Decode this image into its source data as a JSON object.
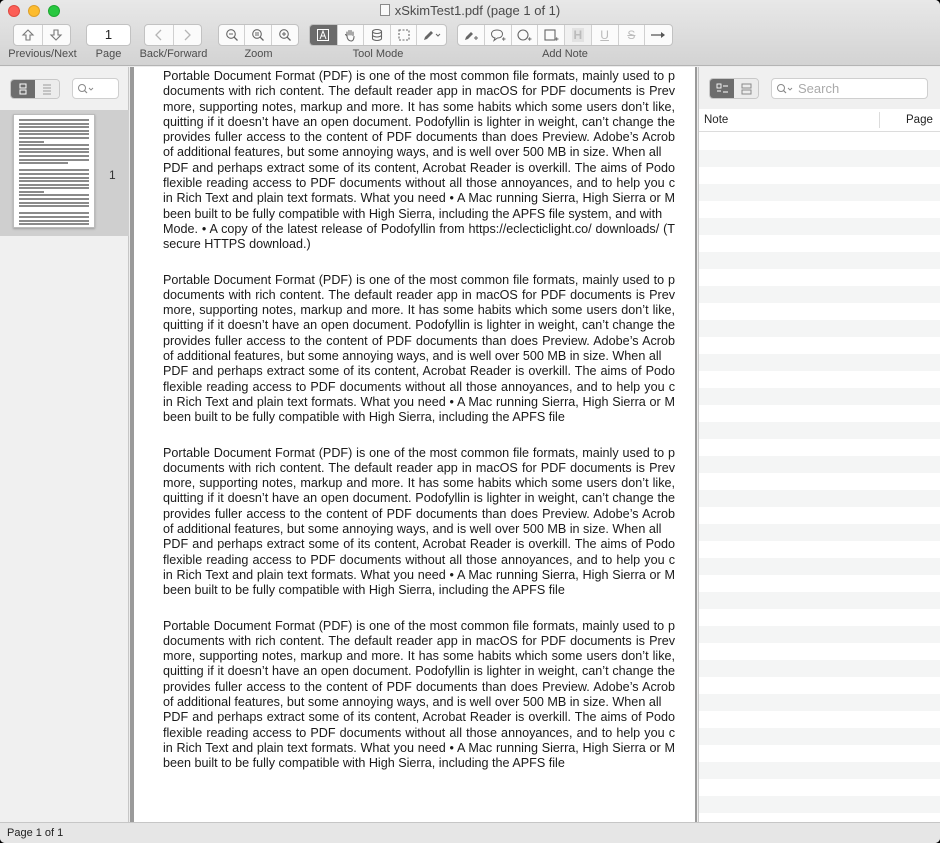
{
  "window": {
    "title": "xSkimTest1.pdf (page 1 of 1)"
  },
  "toolbar": {
    "page_number": "1",
    "labels": {
      "previous_next": "Previous/Next",
      "page": "Page",
      "back_forward": "Back/Forward",
      "zoom": "Zoom",
      "tool_mode": "Tool Mode",
      "add_note": "Add Note"
    },
    "add_note_letter_h": "H",
    "add_note_letter_u": "U",
    "add_note_letter_s": "S",
    "active_tool": "text-tool"
  },
  "left_sidebar": {
    "thumbnails": [
      {
        "page_label": "1"
      }
    ]
  },
  "document": {
    "blocks": [
      {
        "p1": "Portable Document Format (PDF) is one of the most common file formats, mainly used to p documents with rich content. The default reader app in macOS for PDF documents is Prev more, supporting notes, markup and more. It has some habits which some users don’t like, quitting if it doesn’t have an open document. Podofyllin is lighter in weight, can’t change the provides fuller access to the content of PDF documents than does Preview. Adobe’s Acrob of additional features, but some annoying ways, and is well over 500 MB in size. When all",
        "p2": "PDF and perhaps extract some of its content, Acrobat Reader is overkill. The aims of Podo flexible reading access to PDF documents without all those annoyances, and to help you c in Rich Text and plain text formats. What you need • A Mac running Sierra, High Sierra or M been built to be fully compatible with High Sierra, including the APFS file system, and with",
        "p3": "Mode. • A copy of the latest release of Podofyllin from https://eclecticlight.co/ downloads/ (T secure HTTPS download.)"
      },
      {
        "p1": "Portable Document Format (PDF) is one of the most common file formats, mainly used to p documents with rich content. The default reader app in macOS for PDF documents is Prev more, supporting notes, markup and more. It has some habits which some users don’t like, quitting if it doesn’t have an open document. Podofyllin is lighter in weight, can’t change the provides fuller access to the content of PDF documents than does Preview. Adobe’s Acrob of additional features, but some annoying ways, and is well over 500 MB in size. When all",
        "p2": "PDF and perhaps extract some of its content, Acrobat Reader is overkill. The aims of Podo flexible reading access to PDF documents without all those annoyances, and to help you c in Rich Text and plain text formats. What you need • A Mac running Sierra, High Sierra or M been built to be fully compatible with High Sierra, including the APFS file"
      },
      {
        "p1": "Portable Document Format (PDF) is one of the most common file formats, mainly used to p documents with rich content. The default reader app in macOS for PDF documents is Prev more, supporting notes, markup and more. It has some habits which some users don’t like, quitting if it doesn’t have an open document. Podofyllin is lighter in weight, can’t change the provides fuller access to the content of PDF documents than does Preview. Adobe’s Acrob of additional features, but some annoying ways, and is well over 500 MB in size. When all",
        "p2": "PDF and perhaps extract some of its content, Acrobat Reader is overkill. The aims of Podo flexible reading access to PDF documents without all those annoyances, and to help you c in Rich Text and plain text formats. What you need • A Mac running Sierra, High Sierra or M been built to be fully compatible with High Sierra, including the APFS file"
      },
      {
        "p1": "Portable Document Format (PDF) is one of the most common file formats, mainly used to p documents with rich content. The default reader app in macOS for PDF documents is Prev more, supporting notes, markup and more. It has some habits which some users don’t like, quitting if it doesn’t have an open document. Podofyllin is lighter in weight, can’t change the provides fuller access to the content of PDF documents than does Preview. Adobe’s Acrob of additional features, but some annoying ways, and is well over 500 MB in size. When all",
        "p2": "PDF and perhaps extract some of its content, Acrobat Reader is overkill. The aims of Podo flexible reading access to PDF documents without all those annoyances, and to help you c in Rich Text and plain text formats. What you need • A Mac running Sierra, High Sierra or M been built to be fully compatible with High Sierra, including the APFS file"
      }
    ]
  },
  "right_sidebar": {
    "search_placeholder": "Search",
    "columns": {
      "note": "Note",
      "page": "Page"
    }
  },
  "status_bar": {
    "text": "Page 1 of 1"
  },
  "colors": {
    "close": "#fc5f57",
    "minimize": "#fdbc2e",
    "zoom": "#28c840",
    "active_segment": "#6b6b6b"
  }
}
